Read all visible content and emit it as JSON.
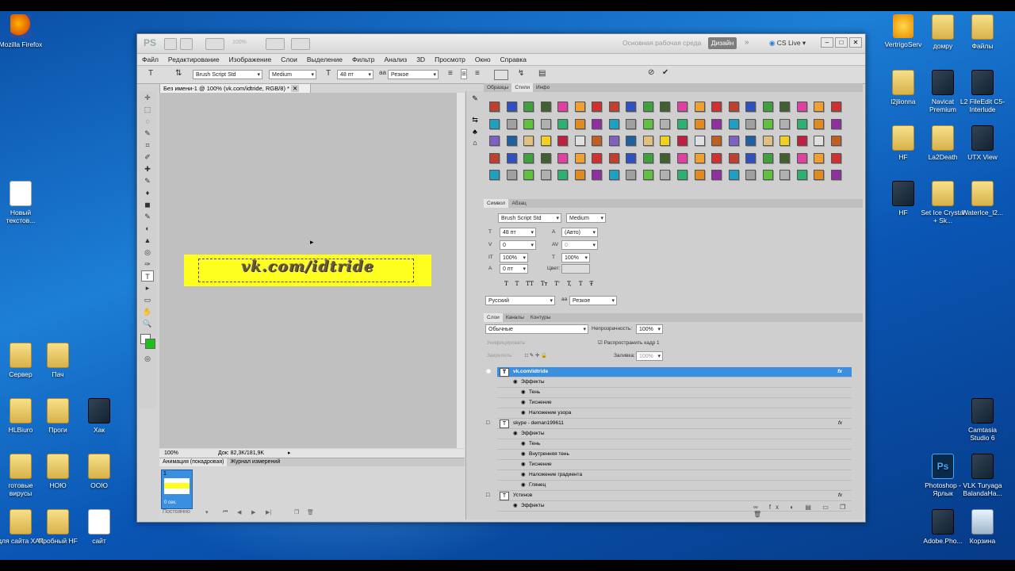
{
  "desktop": {
    "left_icons": [
      {
        "label": "Mozilla Firefox",
        "kind": "ff"
      },
      {
        "label": "Новый текстов...",
        "kind": "doc"
      },
      {
        "label": "Сервер",
        "kind": "folder"
      },
      {
        "label": "Пач",
        "kind": "folder"
      },
      {
        "label": "HLBiuro",
        "kind": "folder"
      },
      {
        "label": "Проги",
        "kind": "folder"
      },
      {
        "label": "Хак",
        "kind": "app"
      },
      {
        "label": "готовые вирусы",
        "kind": "folder"
      },
      {
        "label": "НОЮ",
        "kind": "folder"
      },
      {
        "label": "ООЮ",
        "kind": "folder"
      },
      {
        "label": "для сайта ХАК",
        "kind": "folder"
      },
      {
        "label": "Пробный HF",
        "kind": "folder"
      },
      {
        "label": "сайт",
        "kind": "doc"
      }
    ],
    "right_icons": [
      {
        "label": "VertrigoServ",
        "kind": "star"
      },
      {
        "label": "домру",
        "kind": "folder"
      },
      {
        "label": "Файлы",
        "kind": "folder"
      },
      {
        "label": "l2jlionna",
        "kind": "folder"
      },
      {
        "label": "Navicat Premium",
        "kind": "app"
      },
      {
        "label": "L2 FileEdit C5-Interlude",
        "kind": "app"
      },
      {
        "label": "HF",
        "kind": "folder"
      },
      {
        "label": "La2Death",
        "kind": "folder"
      },
      {
        "label": "UTX View",
        "kind": "app"
      },
      {
        "label": "HF",
        "kind": "app"
      },
      {
        "label": "Set Ice Crystal + Sk...",
        "kind": "folder"
      },
      {
        "label": "WaterIce_l2...",
        "kind": "folder"
      },
      {
        "label": "Camtasia Studio 6",
        "kind": "app"
      },
      {
        "label": "Photoshop - Ярлык",
        "kind": "ps"
      },
      {
        "label": "VLK Turyaga BalandaHa...",
        "kind": "app"
      },
      {
        "label": "Adobe.Pho...",
        "kind": "app"
      },
      {
        "label": "Корзина",
        "kind": "bin"
      }
    ]
  },
  "photoshop": {
    "logo": "PS",
    "zoom_label": "100%",
    "workspace_label": "Основная рабочая среда",
    "design_label": "Дизайн",
    "cslive_label": "CS Live",
    "menu": [
      "Файл",
      "Редактирование",
      "Изображение",
      "Слои",
      "Выделение",
      "Фильтр",
      "Анализ",
      "3D",
      "Просмотр",
      "Окно",
      "Справка"
    ],
    "options": {
      "font_family": "Brush Script Std",
      "font_style": "Medium",
      "font_size": "48 пт",
      "antialias": "Резкое"
    },
    "document": {
      "tab_title": "Без имени-1 @ 100% (vk.com/idtride, RGB/8) *",
      "banner_text": "vk.com/idtride",
      "banner_color": "#ffff1f",
      "zoom": "100%",
      "doc_size": "Док: 82,3K/181,9K"
    },
    "animation": {
      "tabs": [
        "Анимация (покадровая)",
        "Журнал измерений"
      ],
      "frame_number": "1",
      "frame_duration": "0 сек.",
      "loop": "Постоянно"
    },
    "styles_panel": {
      "tabs": [
        "Образцы",
        "Стили",
        "Инфо"
      ],
      "swatches": [
        "#c04030",
        "#e08a20",
        "#f2d020",
        "#3050c0",
        "#9030a0",
        "#c02040",
        "#40a040",
        "#20a0c0",
        "#e0e0e0",
        "#406030",
        "#a0a0a0",
        "#c06020",
        "#e040a0",
        "#60c040",
        "#8060c0",
        "#f0a030",
        "#b0b0b0",
        "#2060a0",
        "#d03030",
        "#30b070",
        "#e0c080"
      ]
    },
    "character_panel": {
      "tabs": [
        "Символ",
        "Абзац"
      ],
      "font_family": "Brush Script Std",
      "font_style": "Medium",
      "size": "48 пт",
      "leading": "(Авто)",
      "kerning": "0",
      "tracking": "0",
      "vscale": "100%",
      "hscale": "100%",
      "baseline": "0 пт",
      "color_label": "Цвет:",
      "glyph_buttons": [
        "T",
        "T",
        "TT",
        "Tт",
        "T'",
        "T,",
        "T",
        "Ŧ"
      ],
      "language": "Русский",
      "antialias": "Резкое"
    },
    "layers_panel": {
      "tabs": [
        "Слои",
        "Каналы",
        "Контуры"
      ],
      "blend_mode": "Обычные",
      "opacity_label": "Непрозрачность:",
      "opacity": "100%",
      "unify_label": "Унифицировать:",
      "propagate_label": "Распространить кадр 1",
      "lock_label": "Закрепить:",
      "fill_label": "Заливка:",
      "fill": "100%",
      "rows": [
        {
          "label": "vk.com/idtride",
          "type": "layer",
          "selected": true
        },
        {
          "label": "Эффекты",
          "type": "effects"
        },
        {
          "label": "Тень",
          "type": "effect"
        },
        {
          "label": "Тиснение",
          "type": "effect"
        },
        {
          "label": "Наложение узора",
          "type": "effect"
        },
        {
          "label": "skype - deman199611",
          "type": "layer"
        },
        {
          "label": "Эффекты",
          "type": "effects"
        },
        {
          "label": "Тень",
          "type": "effect"
        },
        {
          "label": "Внутренняя тень",
          "type": "effect"
        },
        {
          "label": "Тиснение",
          "type": "effect"
        },
        {
          "label": "Наложение градиента",
          "type": "effect"
        },
        {
          "label": "Глянец",
          "type": "effect"
        },
        {
          "label": "Устинов",
          "type": "layer"
        },
        {
          "label": "Эффекты",
          "type": "effects"
        }
      ]
    }
  }
}
